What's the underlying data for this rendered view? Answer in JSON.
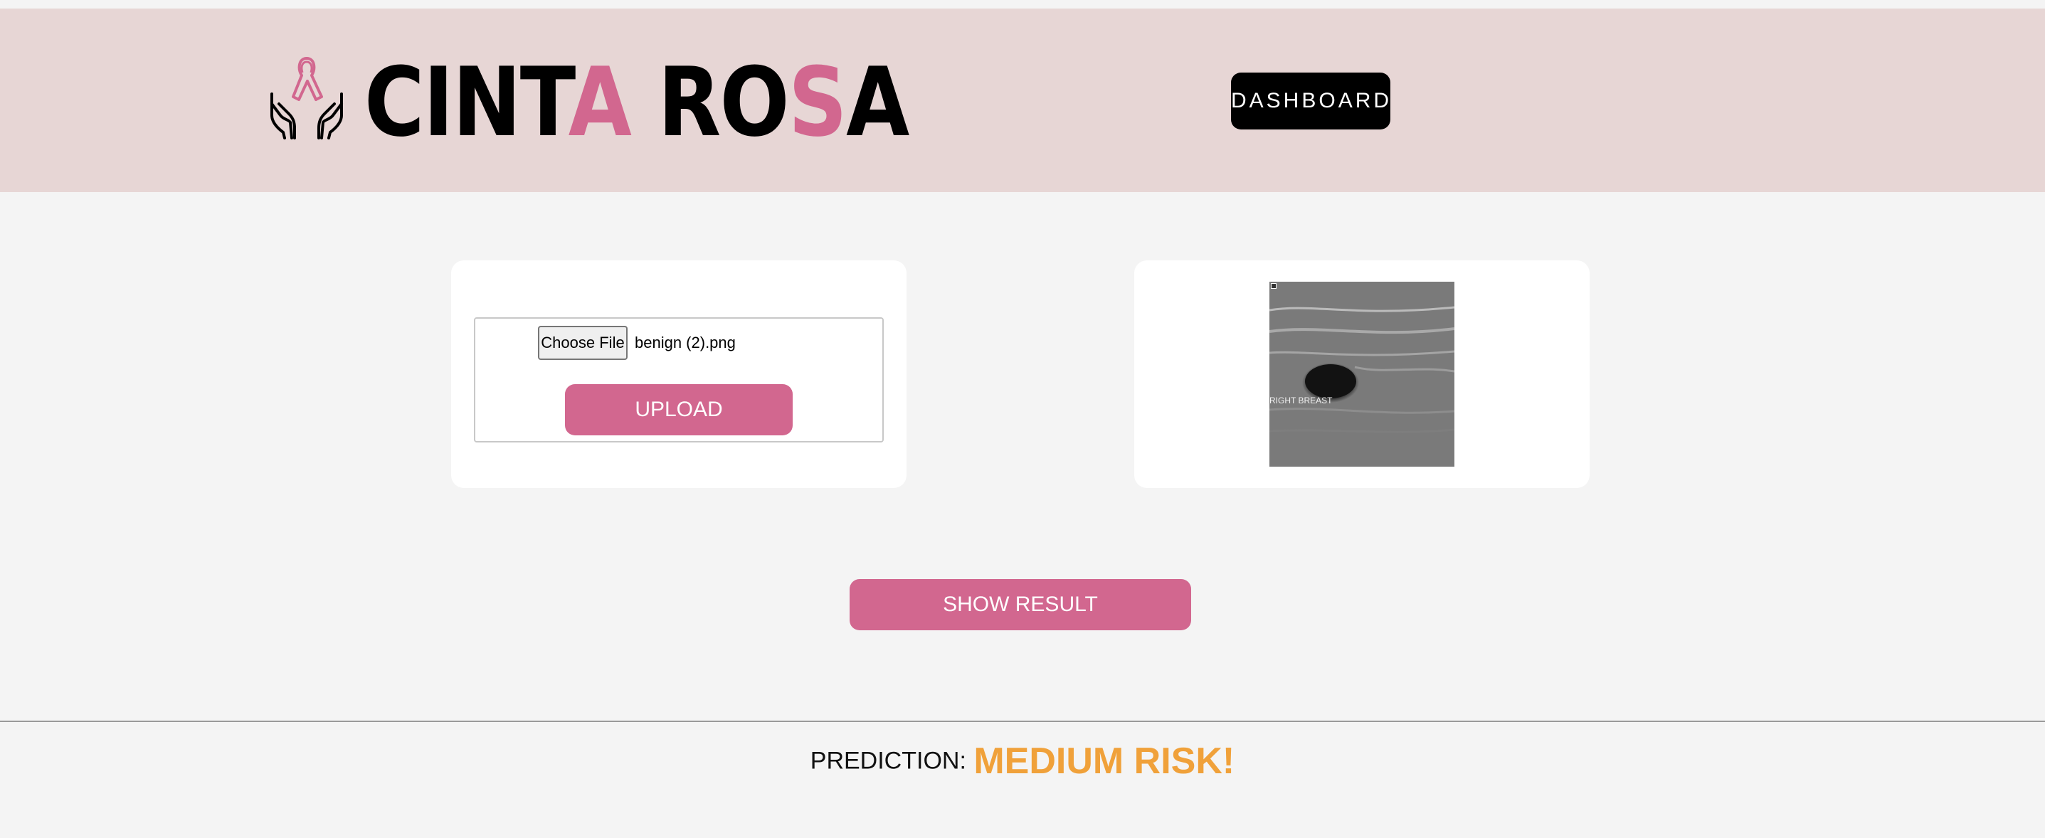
{
  "header": {
    "logo_parts": [
      "CINT",
      "A",
      " RO",
      "S",
      "A"
    ],
    "dashboard_label": "DASHBOARD"
  },
  "upload_card": {
    "choose_file_label": "Choose File",
    "file_name": "benign (2).png",
    "upload_label": "UPLOAD"
  },
  "preview_card": {
    "image_overlay_text": "RIGHT BREAST"
  },
  "actions": {
    "show_result_label": "SHOW RESULT"
  },
  "prediction": {
    "label": "PREDICTION:",
    "value": "MEDIUM RISK!",
    "value_color": "#f0a13a"
  },
  "colors": {
    "brand_pink": "#d2678f",
    "header_bg": "#e7d6d5",
    "page_bg": "#f4f4f4"
  },
  "icons": {
    "logo": "hands-holding-ribbon-icon"
  }
}
